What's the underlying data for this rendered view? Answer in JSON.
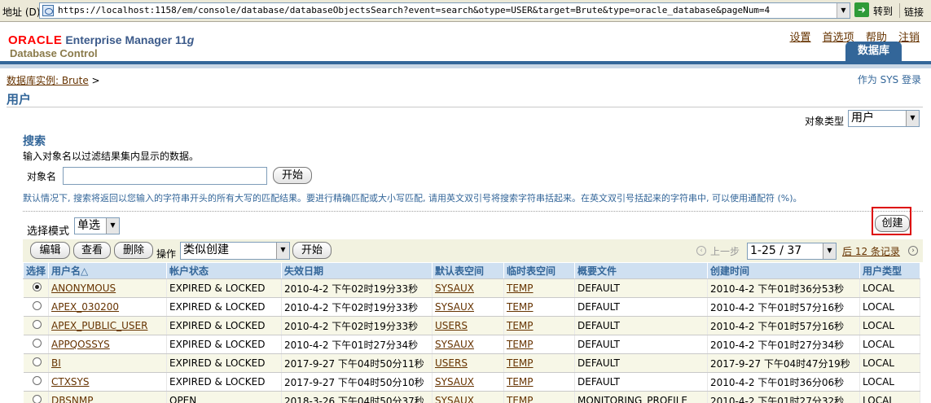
{
  "browser": {
    "address_label": "地址 (D)",
    "url": "https://localhost:1158/em/console/database/databaseObjectsSearch?event=search&otype=USER&target=Brute&type=oracle_database&pageNum=4",
    "go_label": "转到",
    "links_label": "链接"
  },
  "header": {
    "brand_oracle": "ORACLE",
    "brand_em": "Enterprise Manager 11",
    "brand_g": "g",
    "brand_dc": "Database Control",
    "links": [
      "设置",
      "首选项",
      "帮助",
      "注销"
    ],
    "active_tab": "数据库"
  },
  "breadcrumb": {
    "link": "数据库实例: Brute",
    "sep": ">"
  },
  "login_info": "作为 SYS 登录",
  "page_title": "用户",
  "object_type": {
    "label": "对象类型",
    "value": "用户"
  },
  "search": {
    "title": "搜索",
    "description": "输入对象名以过滤结果集内显示的数据。",
    "field_label": "对象名",
    "field_value": "",
    "go_button": "开始",
    "hint": "默认情况下, 搜索将返回以您输入的字符串开头的所有大写的匹配结果。要进行精确匹配或大小写匹配, 请用英文双引号将搜索字符串括起来。在英文双引号括起来的字符串中, 可以使用通配符 (%)。"
  },
  "select_mode": {
    "label": "选择模式",
    "value": "单选"
  },
  "create_button": "创建",
  "toolbar": {
    "edit": "编辑",
    "view": "查看",
    "delete": "删除",
    "action_label": "操作",
    "action_value": "类似创建",
    "go": "开始",
    "prev": "上一步",
    "range": "1-25 / 37",
    "next": "后 12 条记录"
  },
  "table": {
    "headers": [
      "选择",
      "用户名△",
      "帐户状态",
      "失效日期",
      "默认表空间",
      "临时表空间",
      "概要文件",
      "创建时间",
      "用户类型"
    ],
    "rows": [
      {
        "selected": true,
        "cells": [
          "ANONYMOUS",
          "EXPIRED & LOCKED",
          "2010-4-2 下午02时19分33秒",
          "SYSAUX",
          "TEMP",
          "DEFAULT",
          "2010-4-2 下午01时36分53秒",
          "LOCAL"
        ]
      },
      {
        "selected": false,
        "cells": [
          "APEX_030200",
          "EXPIRED & LOCKED",
          "2010-4-2 下午02时19分33秒",
          "SYSAUX",
          "TEMP",
          "DEFAULT",
          "2010-4-2 下午01时57分16秒",
          "LOCAL"
        ]
      },
      {
        "selected": false,
        "cells": [
          "APEX_PUBLIC_USER",
          "EXPIRED & LOCKED",
          "2010-4-2 下午02时19分33秒",
          "USERS",
          "TEMP",
          "DEFAULT",
          "2010-4-2 下午01时57分16秒",
          "LOCAL"
        ]
      },
      {
        "selected": false,
        "cells": [
          "APPQOSSYS",
          "EXPIRED & LOCKED",
          "2010-4-2 下午01时27分34秒",
          "SYSAUX",
          "TEMP",
          "DEFAULT",
          "2010-4-2 下午01时27分34秒",
          "LOCAL"
        ]
      },
      {
        "selected": false,
        "cells": [
          "BI",
          "EXPIRED & LOCKED",
          "2017-9-27 下午04时50分11秒",
          "USERS",
          "TEMP",
          "DEFAULT",
          "2017-9-27 下午04时47分19秒",
          "LOCAL"
        ]
      },
      {
        "selected": false,
        "cells": [
          "CTXSYS",
          "EXPIRED & LOCKED",
          "2017-9-27 下午04时50分10秒",
          "SYSAUX",
          "TEMP",
          "DEFAULT",
          "2010-4-2 下午01时36分06秒",
          "LOCAL"
        ]
      },
      {
        "selected": false,
        "cells": [
          "DBSNMP",
          "OPEN",
          "2018-3-26 下午04时50分37秒",
          "SYSAUX",
          "TEMP",
          "MONITORING_PROFILE",
          "2010-4-2 下午01时27分32秒",
          "LOCAL"
        ]
      }
    ]
  },
  "colors": {
    "brand_red": "#ff0000",
    "accent_blue": "#336699",
    "link_brown": "#663300",
    "header_bg": "#cfe0f1",
    "row_alt": "#f7f7e7",
    "highlight_red": "#dd0000"
  }
}
